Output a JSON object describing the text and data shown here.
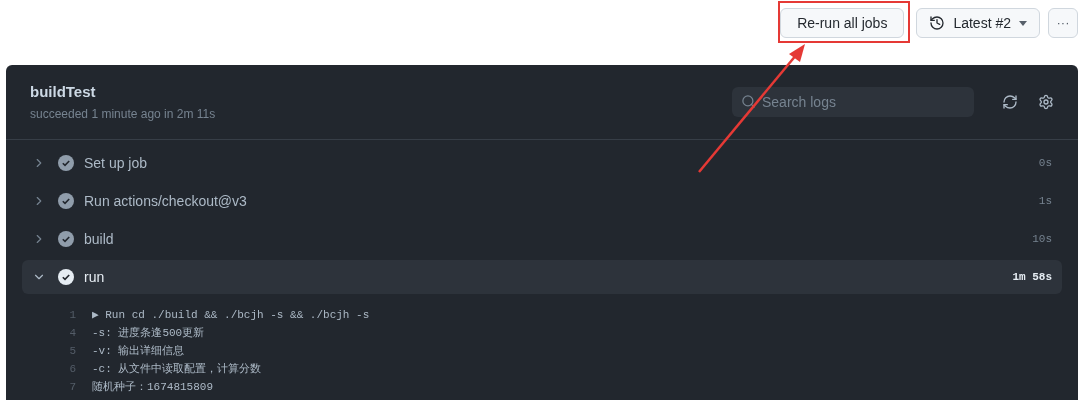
{
  "toolbar": {
    "rerun_button": "Re-run all jobs",
    "attempt_button": "Latest #2",
    "more_button": "···"
  },
  "job": {
    "title": "buildTest",
    "subtitle": "succeeded 1 minute ago in 2m 11s",
    "search": {
      "placeholder": "Search logs"
    }
  },
  "steps": [
    {
      "name": "Set up job",
      "duration": "0s",
      "expanded": false
    },
    {
      "name": "Run actions/checkout@v3",
      "duration": "1s",
      "expanded": false
    },
    {
      "name": "build",
      "duration": "10s",
      "expanded": false
    },
    {
      "name": "run",
      "duration": "1m 58s",
      "expanded": true
    }
  ],
  "log_lines": [
    {
      "number": "1",
      "text": "▶ Run cd ./build && ./bcjh -s && ./bcjh -s"
    },
    {
      "number": "4",
      "text": "-s: 进度条逢500更新"
    },
    {
      "number": "5",
      "text": "-v: 输出详细信息"
    },
    {
      "number": "6",
      "text": "-c: 从文件中读取配置，计算分数"
    },
    {
      "number": "7",
      "text": "随机种子：1674815809"
    }
  ]
}
